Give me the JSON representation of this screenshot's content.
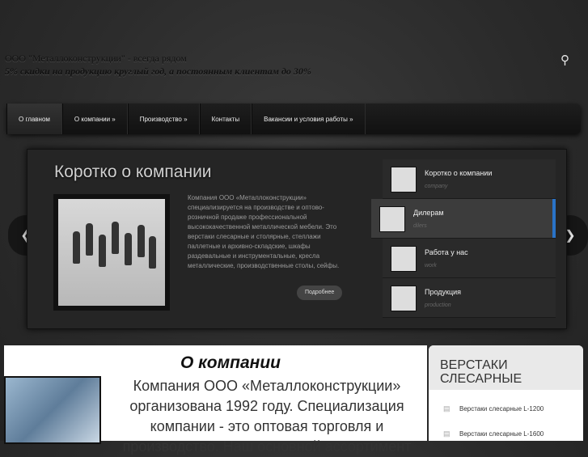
{
  "header": {
    "line1": "ООО \"Металлоконструкции\" - всегда рядом",
    "line2": "5% скидки на продукцию круглый год, а постоянным клиентам до 30%"
  },
  "nav": {
    "items": [
      {
        "label": "О главном"
      },
      {
        "label": "О компании »"
      },
      {
        "label": "Производство »"
      },
      {
        "label": "Контакты"
      },
      {
        "label": "Вакансии и условия работы »"
      }
    ]
  },
  "slider": {
    "title": "Коротко о компании",
    "text": "Компания ООО «Металлоконструкции» специализируется на производстве и оптово-розничной продаже профессиональной высококачественной металлической мебели. Это верстаки слесарные и столярные, стеллажи паллетные и архивно-складские, шкафы раздевальные и инструментальные, кресла металлические, производственные столы, сейфы.",
    "more_label": "Подробнее",
    "thumbs": [
      {
        "title": "Коротко о компании",
        "sub": "company"
      },
      {
        "title": "Дилерам",
        "sub": "dilers"
      },
      {
        "title": "Работа у нас",
        "sub": "work"
      },
      {
        "title": "Продукция",
        "sub": "production"
      }
    ]
  },
  "content": {
    "title": "О компании",
    "text": "Компания ООО «Металлоконструкции» организована 1992 году. Специализация компании - это оптовая торговля и производство. Наш основной ассортимент"
  },
  "sidebar": {
    "title_line1": "ВЕРСТАКИ",
    "title_line2": "СЛЕСАРНЫЕ",
    "links": [
      "Верстаки слесарные L-1200",
      "Верстаки слесарные L-1600"
    ]
  },
  "colors": {
    "accent": "#2a73c8"
  }
}
